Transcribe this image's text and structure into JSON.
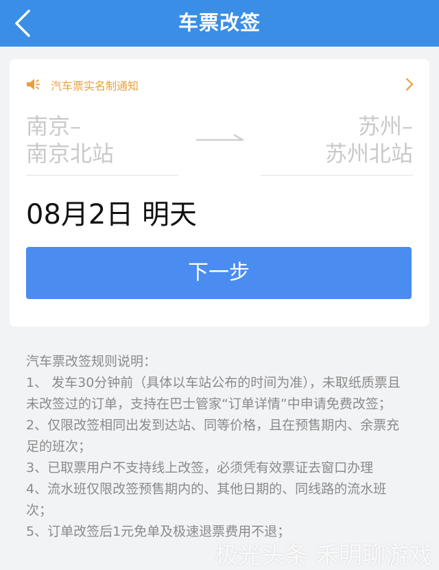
{
  "header": {
    "title": "车票改签",
    "back_icon": "chevron-left-icon",
    "background": "#3a8ee6"
  },
  "notice": {
    "text": "汽车票实名制通知",
    "icon": "speaker-icon",
    "color": "#e8a03c"
  },
  "route": {
    "from_city": "南京–",
    "from_station": "南京北站",
    "to_city": "苏州–",
    "to_station": "苏州北站"
  },
  "date": {
    "value": "08月2日 明天"
  },
  "next_button": {
    "label": "下一步",
    "color": "#4a8cf0"
  },
  "rules": {
    "title": "汽车票改签规则说明：",
    "items": [
      "1、 发车30分钟前（具体以车站公布的时间为准），未取纸质票且未改签过的订单，支持在巴士管家“订单详情”中申请免费改签；",
      "2、仅限改签相同出发到达站、同等价格，且在预售期内、余票充足的班次；",
      "3、已取票用户不支持线上改签，必须凭有效票证去窗口办理",
      "4、流水班仅限改签预售期内的、其他日期的、同线路的流水班次；",
      "5、订单改签后1元免单及极速退票费用不退；"
    ]
  },
  "watermark": {
    "text": "极光头条 禾明聊游戏"
  }
}
